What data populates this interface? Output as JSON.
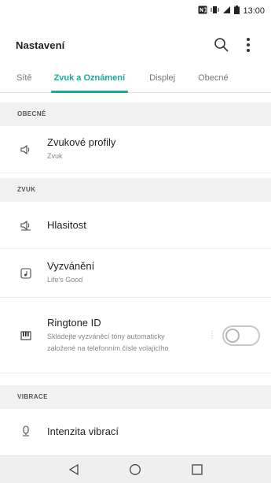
{
  "status_bar": {
    "time": "13:00"
  },
  "app": {
    "title": "Nastavení",
    "search_icon": "search-icon",
    "more_icon": "more-vert-icon"
  },
  "tabs": [
    {
      "label": "Sítě",
      "active": false
    },
    {
      "label": "Zvuk a Oznámení",
      "active": true
    },
    {
      "label": "Displej",
      "active": false
    },
    {
      "label": "Obecné",
      "active": false
    }
  ],
  "sections": {
    "general": "OBECNÉ",
    "sound": "ZVUK",
    "vibration": "VIBRACE"
  },
  "items": {
    "sound_profiles": {
      "title": "Zvukové profily",
      "subtitle": "Zvuk",
      "icon": "speaker-icon"
    },
    "volume": {
      "title": "Hlasitost",
      "icon": "volume-icon"
    },
    "ringtone": {
      "title": "Vyzvánění",
      "subtitle": "Life's Good",
      "icon": "music-note-icon"
    },
    "ringtone_id": {
      "title": "Ringtone ID",
      "subtitle": "Skládejte vyzváněcí tóny automaticky založené na telefonním čísle volajícího",
      "icon": "piano-icon",
      "enabled": false
    },
    "vibration_intensity": {
      "title": "Intenzita vibrací",
      "icon": "vibration-icon"
    }
  },
  "accent_color": "#1aa99b",
  "nav_bar": {
    "back_icon": "back-icon",
    "home_icon": "home-icon",
    "recents_icon": "recents-icon"
  }
}
